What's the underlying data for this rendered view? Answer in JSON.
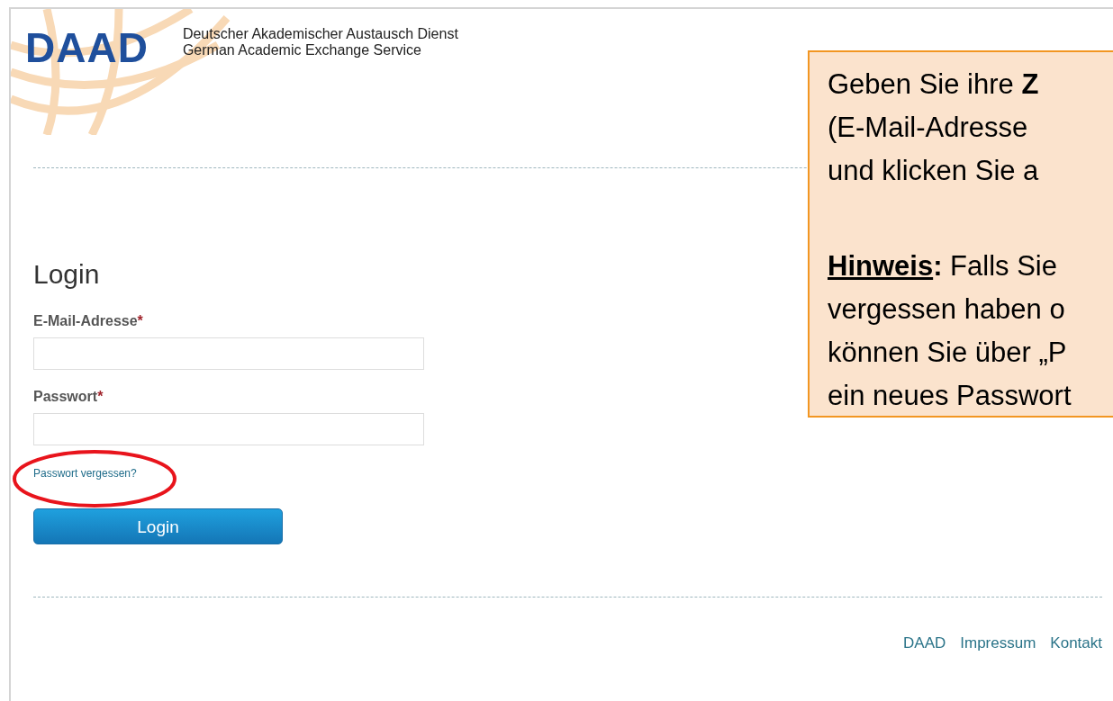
{
  "header": {
    "logo": "DAAD",
    "tagline_lines": [
      "Deutscher Akademischer Austausch Dienst",
      "German Academic Exchange Service"
    ]
  },
  "login": {
    "title": "Login",
    "fields": [
      {
        "label": "E-Mail-Adresse",
        "required_mark": "*"
      },
      {
        "label": "Passwort",
        "required_mark": "*"
      }
    ],
    "forgot_link": {
      "text": "Passwort vergessen?",
      "highlighted": true
    },
    "submit_button": "Login"
  },
  "footer_links": [
    "DAAD",
    "Impressum",
    "Kontakt"
  ],
  "callout": {
    "lines": [
      {
        "kind": "text",
        "text": "Geben Sie ihre **Z**"
      },
      {
        "kind": "text",
        "text": "(E-Mail-Adresse"
      },
      {
        "kind": "text",
        "text": "und klicken Sie a"
      },
      {
        "kind": "gap"
      },
      {
        "kind": "note",
        "lead": "Hinweis",
        "lead_end": ":",
        "text": "Falls Sie"
      },
      {
        "kind": "text",
        "text": "vergessen haben o"
      },
      {
        "kind": "text",
        "text": "können Sie über „P"
      },
      {
        "kind": "text",
        "text": "ein neues Passwort"
      }
    ]
  }
}
